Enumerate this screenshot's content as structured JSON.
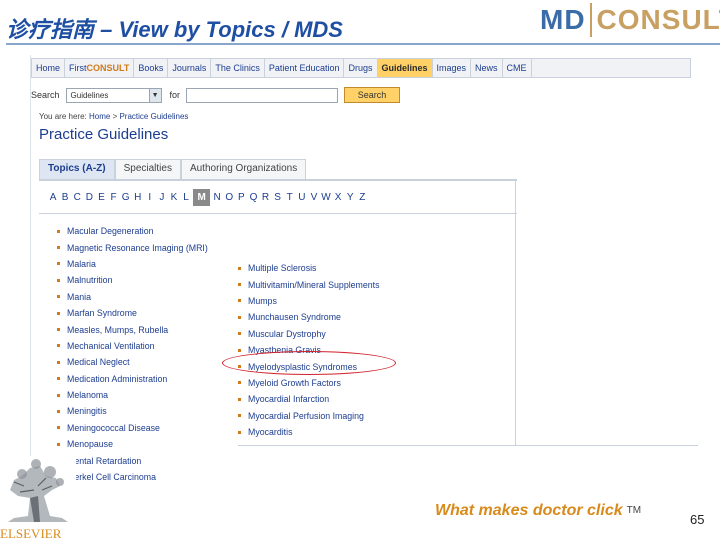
{
  "slide": {
    "title": "诊疗指南 – View by Topics / MDS",
    "logo_left": "MD",
    "logo_right": "CONSULT",
    "tagline": "What makes doctor click",
    "tm": "TM",
    "page_number": "65",
    "publisher": "ELSEVIER"
  },
  "nav": {
    "items": [
      {
        "label": "Home"
      },
      {
        "label_a": "First",
        "label_b": "CONSULT"
      },
      {
        "label": "Books"
      },
      {
        "label": "Journals"
      },
      {
        "label": "The Clinics"
      },
      {
        "label": "Patient Education"
      },
      {
        "label": "Drugs"
      },
      {
        "label": "Guidelines"
      },
      {
        "label": "Images"
      },
      {
        "label": "News"
      },
      {
        "label": "CME"
      }
    ]
  },
  "search": {
    "label": "Search",
    "scope_value": "Guidelines",
    "for_label": "for",
    "query_value": "",
    "button_label": "Search"
  },
  "breadcrumb": {
    "prefix": "You are here:",
    "home": "Home",
    "sep": ">",
    "current": "Practice Guidelines"
  },
  "page": {
    "title": "Practice Guidelines"
  },
  "tabs": [
    {
      "label": "Topics (A-Z)",
      "active": true
    },
    {
      "label": "Specialties",
      "active": false
    },
    {
      "label": "Authoring Organizations",
      "active": false
    }
  ],
  "alphabet": [
    "A",
    "B",
    "C",
    "D",
    "E",
    "F",
    "G",
    "H",
    "I",
    "J",
    "K",
    "L",
    "M",
    "N",
    "O",
    "P",
    "Q",
    "R",
    "S",
    "T",
    "U",
    "V",
    "W",
    "X",
    "Y",
    "Z"
  ],
  "alphabet_selected": "M",
  "topics_col_a": [
    "Macular Degeneration",
    "Magnetic Resonance Imaging (MRI)",
    "Malaria",
    "Malnutrition",
    "Mania",
    "Marfan Syndrome",
    "Measles, Mumps, Rubella",
    "Mechanical Ventilation",
    "Medical Neglect",
    "Medication Administration",
    "Melanoma",
    "Meningitis",
    "Meningococcal Disease",
    "Menopause",
    "Mental Retardation",
    "Merkel Cell Carcinoma"
  ],
  "topics_col_b": [
    "Multiple Sclerosis",
    "Multivitamin/Mineral Supplements",
    "Mumps",
    "Munchausen Syndrome",
    "Muscular Dystrophy",
    "Myasthenia Gravis",
    "Myelodysplastic Syndromes",
    "Myeloid Growth Factors",
    "Myocardial Infarction",
    "Myocardial Perfusion Imaging",
    "Myocarditis"
  ],
  "highlighted_topic": "Myelodysplastic Syndromes",
  "colors": {
    "title": "#1e4fa3",
    "link": "#1c3d8f",
    "accent": "#d88a1a",
    "highlight_circle": "#d0202a"
  }
}
